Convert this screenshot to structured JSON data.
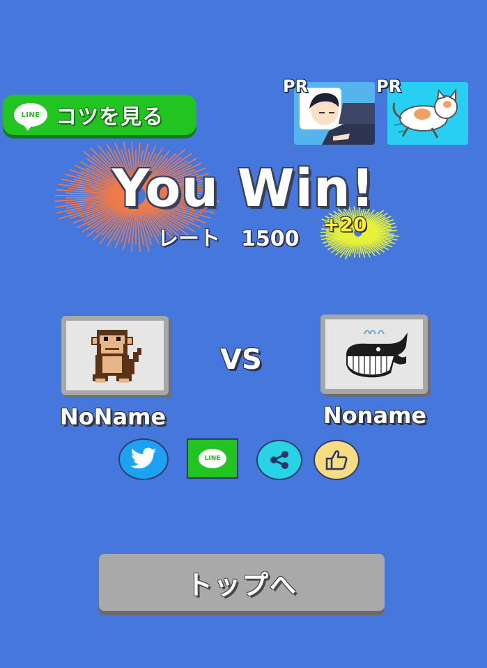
{
  "tips_button": {
    "line_icon_text": "LINE",
    "label": "コツを見る"
  },
  "ads": [
    {
      "label": "PR",
      "icon": "sleeping-man-illustration"
    },
    {
      "label": "PR",
      "icon": "running-cat-illustration"
    }
  ],
  "result": {
    "title": "You Win!",
    "rate_label": "レート",
    "rate_value": "1500",
    "rate_delta": "+20"
  },
  "players": [
    {
      "name": "NoName",
      "avatar": "monkey-pixel-icon"
    },
    {
      "name": "Noname",
      "avatar": "whale-pixel-icon"
    }
  ],
  "vs_label": "VS",
  "share": {
    "twitter_icon": "twitter-bird-icon",
    "line_text": "LINE",
    "share_icon": "share-nodes-icon",
    "like_icon": "thumbs-up-icon"
  },
  "top_button": {
    "label": "トップへ"
  },
  "colors": {
    "background": "#4677dd",
    "line_green": "#22c421",
    "twitter_blue": "#1da1f2",
    "share_cyan": "#29d3e6",
    "like_yellow": "#f6dc83",
    "button_gray": "#a9a9a9",
    "firework_orange": "#f07a4a",
    "firework_yellow": "#e6f23a"
  }
}
